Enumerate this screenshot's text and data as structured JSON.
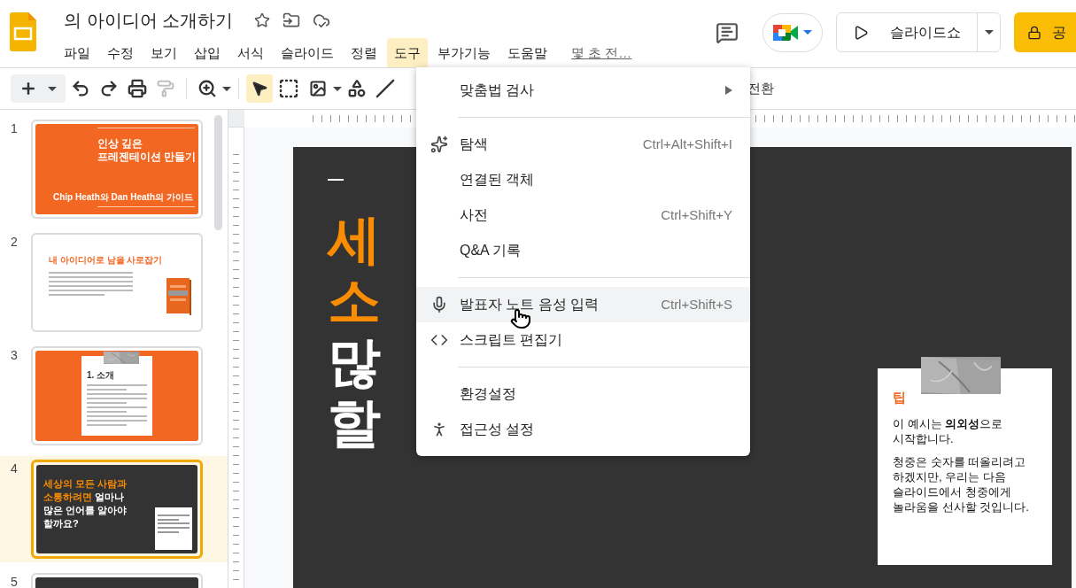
{
  "document": {
    "title": "의 아이디어 소개하기",
    "starred": false,
    "last_edit": "몇 초 전…"
  },
  "menu_bar": [
    {
      "label": "파일",
      "selected": false
    },
    {
      "label": "수정",
      "selected": false
    },
    {
      "label": "보기",
      "selected": false
    },
    {
      "label": "삽입",
      "selected": false
    },
    {
      "label": "서식",
      "selected": false
    },
    {
      "label": "슬라이드",
      "selected": false
    },
    {
      "label": "정렬",
      "selected": false
    },
    {
      "label": "도구",
      "selected": true
    },
    {
      "label": "부가기능",
      "selected": false
    },
    {
      "label": "도움말",
      "selected": false
    }
  ],
  "header_buttons": {
    "slideshow": "슬라이드쇼",
    "share": "공"
  },
  "toolbar": {
    "select_tool_active": true,
    "paint_format_disabled": true,
    "transition": "전환"
  },
  "tools_menu": [
    {
      "kind": "submenu",
      "label": "맞춤법 검사",
      "selected": false
    },
    {
      "kind": "divider"
    },
    {
      "kind": "sparkle",
      "label": "탐색",
      "shortcut": "Ctrl+Alt+Shift+I",
      "selected": false
    },
    {
      "kind": "plain",
      "label": "연결된 객체",
      "selected": false
    },
    {
      "kind": "plain",
      "label": "사전",
      "shortcut": "Ctrl+Shift+Y",
      "selected": false
    },
    {
      "kind": "plain",
      "label": "Q&A 기록",
      "selected": false
    },
    {
      "kind": "divider"
    },
    {
      "kind": "mic",
      "label": "발표자 노트 음성 입력",
      "shortcut": "Ctrl+Shift+S",
      "selected": true
    },
    {
      "kind": "code",
      "label": "스크립트 편집기",
      "selected": false
    },
    {
      "kind": "divider"
    },
    {
      "kind": "plain",
      "label": "환경설정",
      "selected": false
    },
    {
      "kind": "person",
      "label": "접근성 설정",
      "selected": false
    }
  ],
  "slides": [
    {
      "number": "1",
      "kind": "title",
      "selected": false,
      "title_lines": [
        "인상 깊은",
        "프레젠테이션 만들기"
      ],
      "subtitle": "Chip Heath와 Dan Heath의 가이드"
    },
    {
      "number": "2",
      "kind": "intro",
      "selected": false,
      "title": "내 아이디어로 남을 사로잡기"
    },
    {
      "number": "3",
      "kind": "note",
      "selected": false,
      "title": "1. 소개"
    },
    {
      "number": "4",
      "kind": "question",
      "selected": true,
      "lines": [
        [
          {
            "text": "세상의 모든 사람과",
            "accent": true
          }
        ],
        [
          {
            "text": "소통하려면",
            "accent": true
          },
          {
            "text": " 얼마나",
            "accent": false
          }
        ],
        [
          {
            "text": "많은 언어를 알아야",
            "accent": false
          }
        ],
        [
          {
            "text": "할까요?",
            "accent": false
          }
        ]
      ]
    },
    {
      "number": "5",
      "kind": "dark",
      "selected": false
    }
  ],
  "current_slide": {
    "headline": [
      {
        "text": "세",
        "accent": true
      },
      {
        "text": "소",
        "accent": true
      },
      {
        "text": "많",
        "accent": false
      },
      {
        "text": "할",
        "accent": false
      }
    ],
    "tip": {
      "heading": "팁",
      "paragraphs": [
        "이 예시는 **의외성**으로 시작합니다.",
        "청중은 숫자를 떠올리려고 하겠지만, 우리는 다음 슬라이드에서 청중에게 놀라움을 선사할 것입니다."
      ]
    }
  }
}
